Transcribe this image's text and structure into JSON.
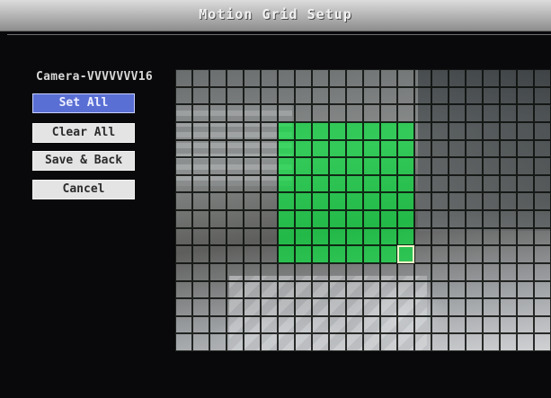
{
  "window": {
    "title": "Motion Grid Setup"
  },
  "camera": {
    "name": "Camera-VVVVVVV16"
  },
  "buttons": {
    "set_all": "Set All",
    "clear_all": "Clear All",
    "save_back": "Save & Back",
    "cancel": "Cancel"
  },
  "grid": {
    "columns": 22,
    "rows": 16,
    "active_region": {
      "col_start": 6,
      "col_end": 13,
      "row_start": 3,
      "row_end": 10
    },
    "cursor": {
      "col": 13,
      "row": 10
    }
  },
  "colors": {
    "active_cell": "#00f03c",
    "selected_button": "#5a6fd4",
    "button": "#e4e4e4"
  }
}
